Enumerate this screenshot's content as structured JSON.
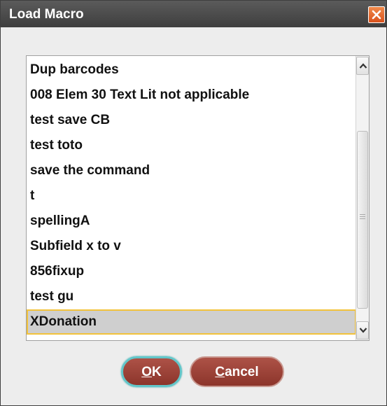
{
  "dialog": {
    "title": "Load Macro"
  },
  "list": {
    "items": [
      "Dup barcodes",
      "008 Elem 30 Text Lit not applicable",
      "test save CB",
      "test toto",
      "save the command",
      "t",
      "spellingA",
      "Subfield x to v",
      "856fixup",
      "test gu",
      "XDonation"
    ],
    "selected_index": 10
  },
  "buttons": {
    "ok": {
      "mnemonic": "O",
      "rest": "K"
    },
    "cancel": {
      "mnemonic": "C",
      "rest": "ancel"
    }
  },
  "colors": {
    "titlebar": "#4a4a4a",
    "close_button": "#e4632a",
    "button_fill": "#9c4438",
    "focus_ring": "#62c6c9",
    "selection_outline": "#f2c23a"
  },
  "icons": {
    "close": "close-x-icon",
    "scroll_up": "chevron-up-icon",
    "scroll_down": "chevron-down-icon"
  }
}
